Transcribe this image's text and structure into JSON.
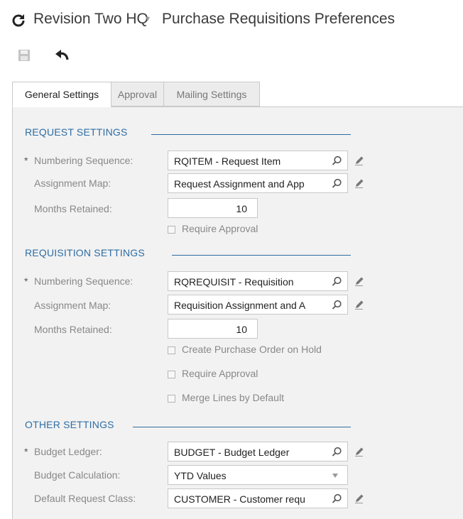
{
  "header": {
    "refresh_icon": "refresh-icon",
    "company": "Revision Two HQ",
    "caret": "▾",
    "page_title": "Purchase Requisitions Preferences"
  },
  "toolbar": {
    "save_icon": "save-icon",
    "undo_icon": "undo-icon"
  },
  "tabs": [
    {
      "label": "General Settings",
      "active": true
    },
    {
      "label": "Approval",
      "active": false
    },
    {
      "label": "Mailing Settings",
      "active": false
    }
  ],
  "request_settings": {
    "header": "REQUEST SETTINGS",
    "numbering_label": "Numbering Sequence:",
    "numbering_value": "RQITEM - Request Item",
    "assignment_label": "Assignment Map:",
    "assignment_value": "Request Assignment and App",
    "months_label": "Months Retained:",
    "months_value": "10",
    "require_approval": "Require Approval"
  },
  "requisition_settings": {
    "header": "REQUISITION SETTINGS",
    "numbering_label": "Numbering Sequence:",
    "numbering_value": "RQREQUISIT - Requisition",
    "assignment_label": "Assignment Map:",
    "assignment_value": "Requisition Assignment and A",
    "months_label": "Months Retained:",
    "months_value": "10",
    "create_po_hold": "Create Purchase Order on Hold",
    "require_approval": "Require Approval",
    "merge_lines": "Merge Lines by Default"
  },
  "other_settings": {
    "header": "OTHER SETTINGS",
    "budget_ledger_label": "Budget Ledger:",
    "budget_ledger_value": "BUDGET - Budget Ledger",
    "budget_calc_label": "Budget Calculation:",
    "budget_calc_value": "YTD Values",
    "default_class_label": "Default Request Class:",
    "default_class_value": "CUSTOMER - Customer requ"
  },
  "required_marker": "*",
  "colors": {
    "section": "#2e6da4",
    "panel": "#f2f2f2"
  }
}
